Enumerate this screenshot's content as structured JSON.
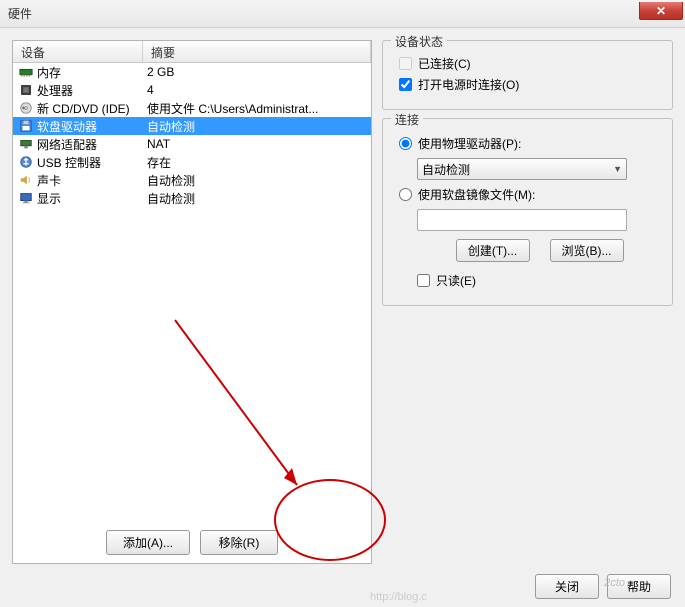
{
  "window": {
    "title": "硬件"
  },
  "table": {
    "headers": {
      "device": "设备",
      "summary": "摘要"
    },
    "rows": [
      {
        "icon": "memory-icon",
        "device": "内存",
        "summary": "2 GB",
        "selected": false
      },
      {
        "icon": "cpu-icon",
        "device": "处理器",
        "summary": "4",
        "selected": false
      },
      {
        "icon": "cd-icon",
        "device": "新 CD/DVD (IDE)",
        "summary": "使用文件 C:\\Users\\Administrat...",
        "selected": false
      },
      {
        "icon": "floppy-icon",
        "device": "软盘驱动器",
        "summary": "自动检测",
        "selected": true
      },
      {
        "icon": "network-icon",
        "device": "网络适配器",
        "summary": "NAT",
        "selected": false
      },
      {
        "icon": "usb-icon",
        "device": "USB 控制器",
        "summary": "存在",
        "selected": false
      },
      {
        "icon": "sound-icon",
        "device": "声卡",
        "summary": "自动检测",
        "selected": false
      },
      {
        "icon": "display-icon",
        "device": "显示",
        "summary": "自动检测",
        "selected": false
      }
    ]
  },
  "buttons": {
    "add": "添加(A)...",
    "remove": "移除(R)",
    "create": "创建(T)...",
    "browse": "浏览(B)...",
    "close": "关闭",
    "help": "帮助"
  },
  "status_group": {
    "title": "设备状态",
    "connected": "已连接(C)",
    "connect_at_power": "打开电源时连接(O)"
  },
  "connection_group": {
    "title": "连接",
    "use_physical": "使用物理驱动器(P):",
    "dropdown_value": "自动检测",
    "use_image": "使用软盘镜像文件(M):",
    "readonly": "只读(E)"
  },
  "watermark1": "2cto",
  "watermark2": "http://blog.c"
}
